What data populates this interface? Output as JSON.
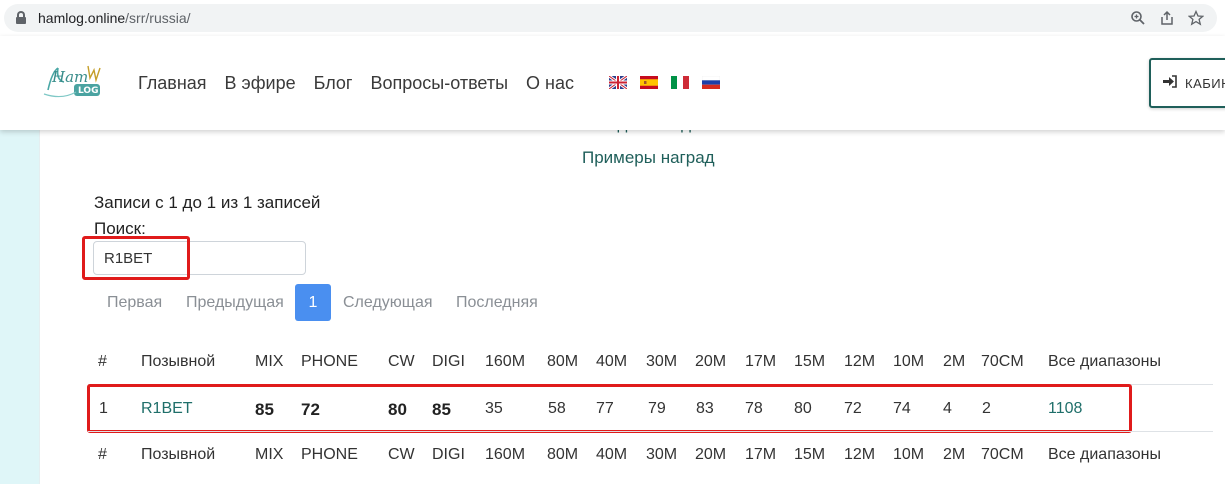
{
  "browser": {
    "url_host": "hamlog.online",
    "url_path": "/srr/russia/"
  },
  "header": {
    "logo_text": "Ham LOG",
    "nav": [
      "Главная",
      "В эфире",
      "Блог",
      "Вопросы-ответы",
      "О нас"
    ],
    "flags": [
      "flag-uk-icon",
      "flag-es-icon",
      "flag-it-icon",
      "flag-ru-icon"
    ],
    "cabinet_label": "КАБИН"
  },
  "main": {
    "link_clipped": "Список выданных дипломов",
    "link_awards": "Примеры наград",
    "records_info": "Записи с 1 до 1 из 1 записей",
    "search_label": "Поиск:",
    "search_value": "R1BET",
    "pagination": {
      "first": "Первая",
      "prev": "Предыдущая",
      "current": "1",
      "next": "Следующая",
      "last": "Последняя"
    }
  },
  "table": {
    "columns": [
      "#",
      "Позывной",
      "MIX",
      "PHONE",
      "CW",
      "DIGI",
      "160M",
      "80M",
      "40M",
      "30M",
      "20M",
      "17M",
      "15M",
      "12M",
      "10M",
      "2M",
      "70CM",
      "Все диапазоны"
    ],
    "row": [
      "1",
      "R1BET",
      "85",
      "72",
      "80",
      "85",
      "35",
      "58",
      "77",
      "79",
      "83",
      "78",
      "80",
      "72",
      "74",
      "4",
      "2",
      "1108"
    ]
  },
  "colors": {
    "accent": "#1f5f5a",
    "active_page": "#4a8ff0",
    "highlight": "#e01b1b",
    "side_band": "#dff6f8"
  }
}
